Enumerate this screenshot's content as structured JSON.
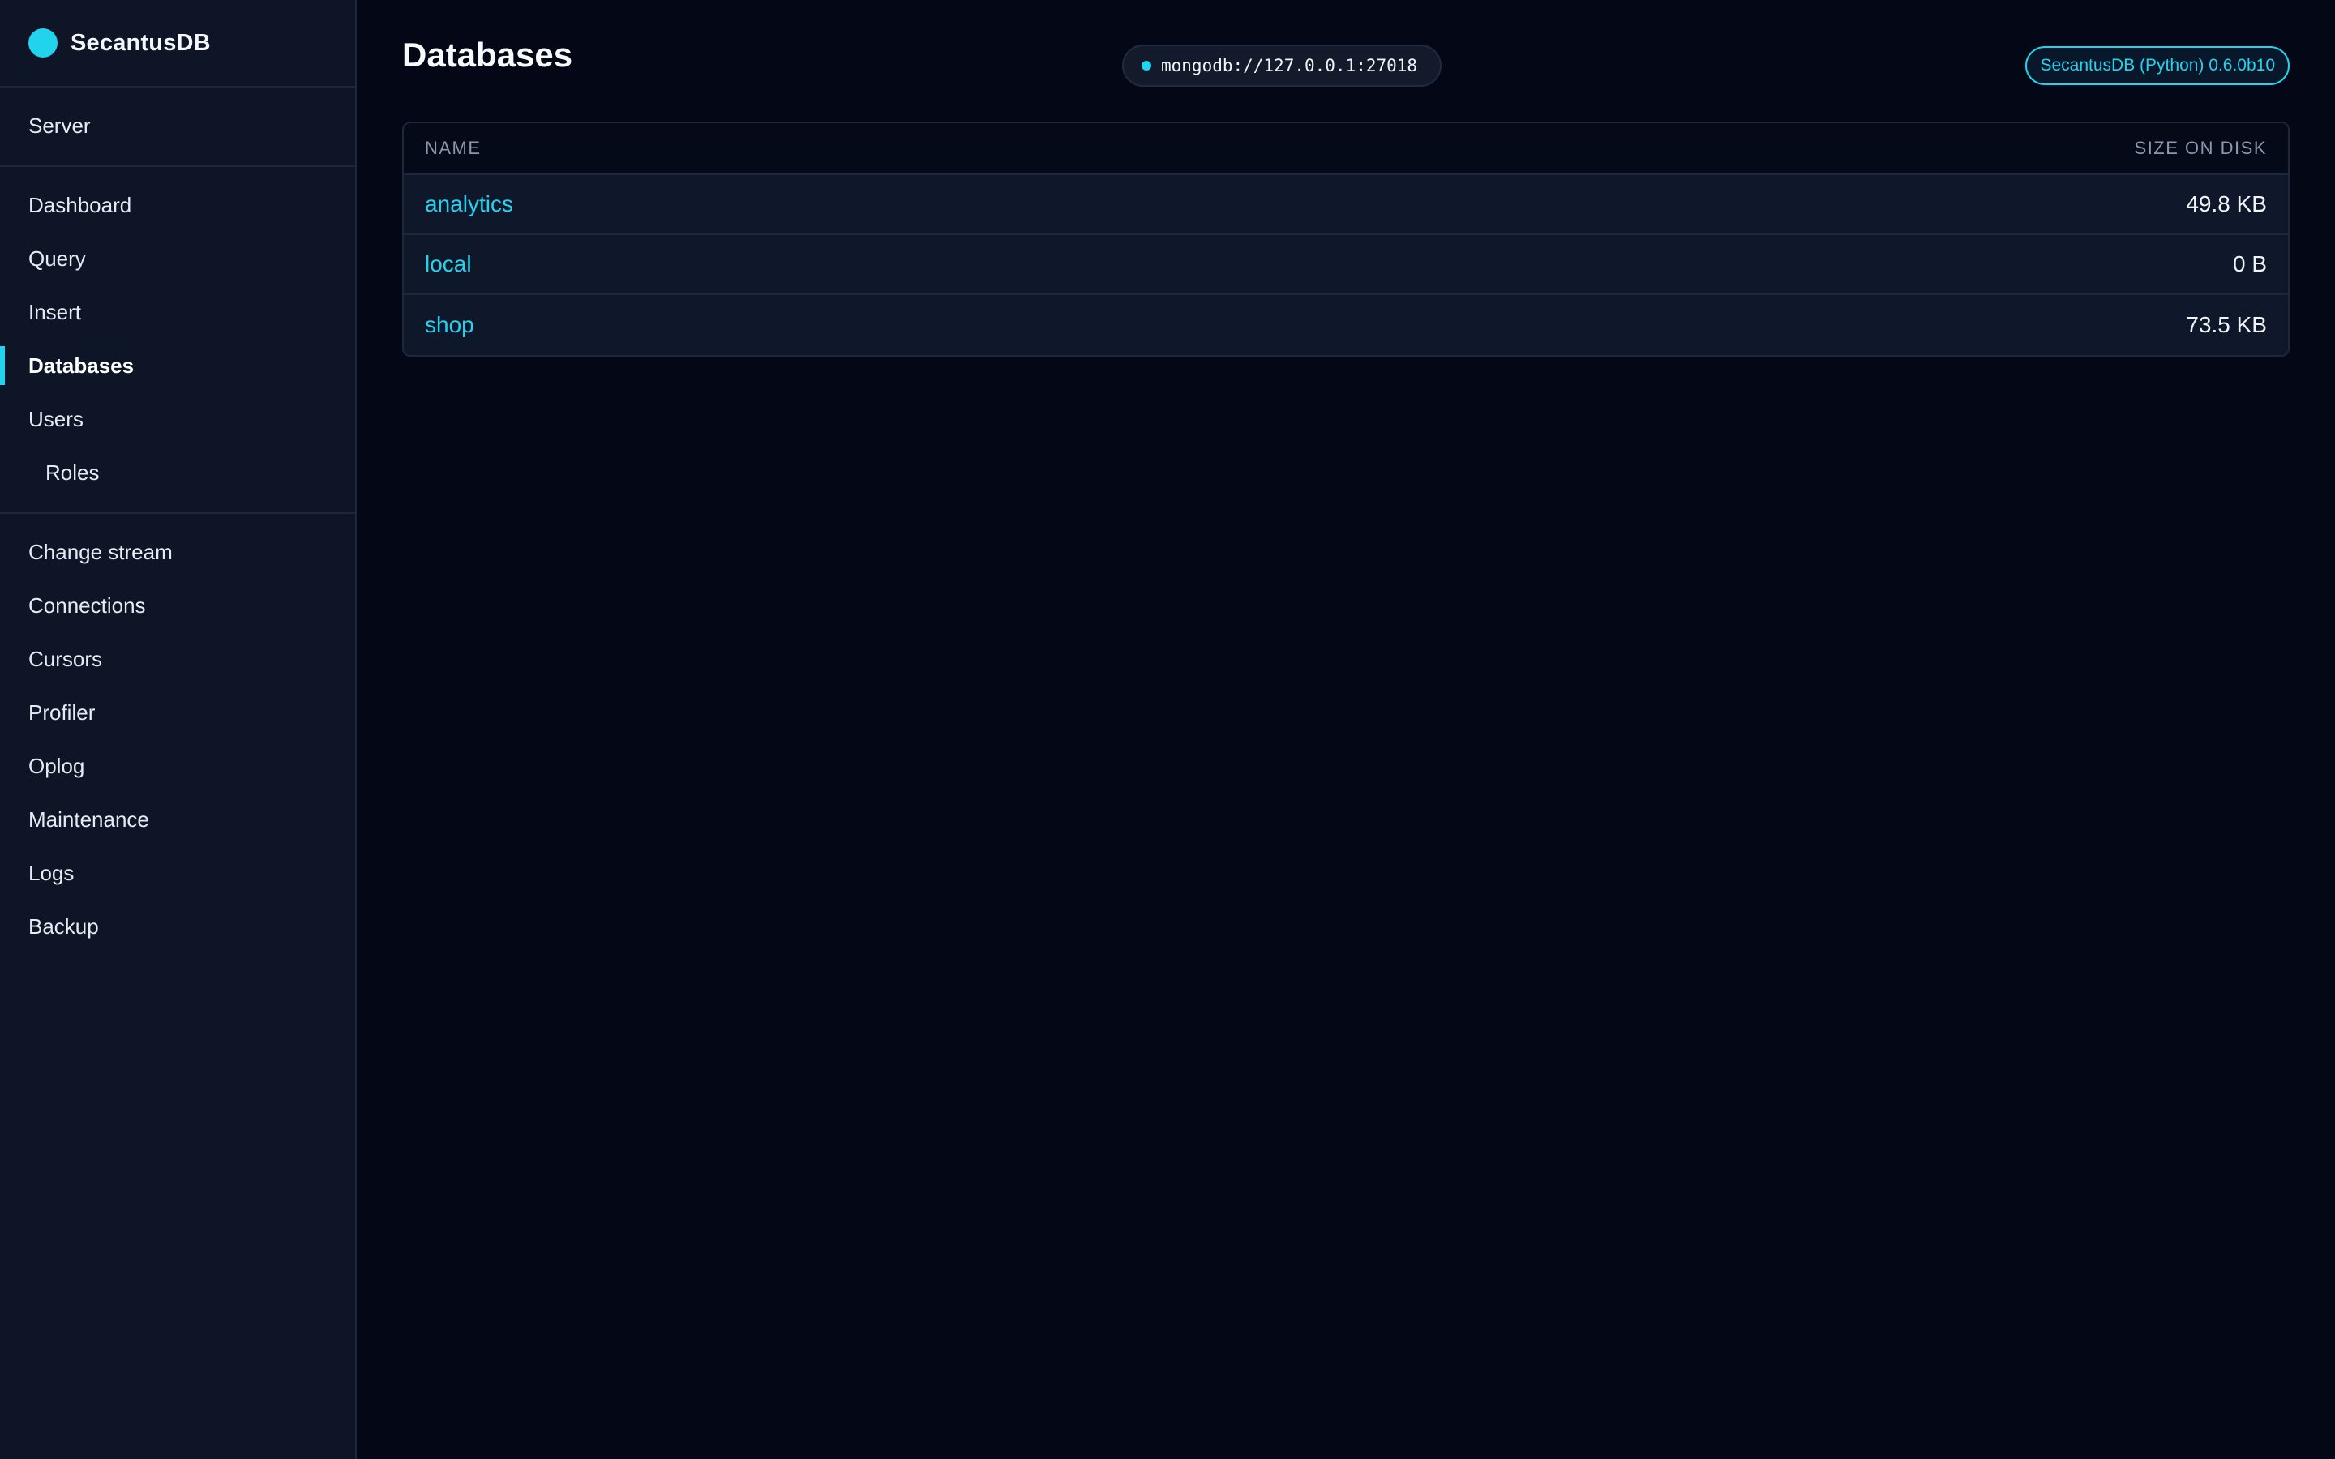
{
  "app": {
    "name": "SecantusDB",
    "accent_color": "#22d3ee"
  },
  "sidebar": {
    "groups": [
      {
        "items": [
          {
            "label": "Server"
          }
        ]
      },
      {
        "items": [
          {
            "label": "Dashboard"
          },
          {
            "label": "Query"
          },
          {
            "label": "Insert"
          },
          {
            "label": "Databases",
            "active": true
          },
          {
            "label": "Users"
          },
          {
            "label": "Roles",
            "sub": true
          }
        ]
      },
      {
        "items": [
          {
            "label": "Change stream"
          },
          {
            "label": "Connections"
          },
          {
            "label": "Cursors"
          },
          {
            "label": "Profiler"
          },
          {
            "label": "Oplog"
          },
          {
            "label": "Maintenance"
          },
          {
            "label": "Logs"
          },
          {
            "label": "Backup"
          }
        ]
      }
    ]
  },
  "header": {
    "title": "Databases",
    "connection": "mongodb://127.0.0.1:27018",
    "version": "SecantusDB (Python) 0.6.0b10"
  },
  "table": {
    "columns": [
      "NAME",
      "SIZE ON DISK"
    ],
    "rows": [
      {
        "name": "analytics",
        "size": "49.8 KB"
      },
      {
        "name": "local",
        "size": "0 B"
      },
      {
        "name": "shop",
        "size": "73.5 KB"
      }
    ]
  }
}
